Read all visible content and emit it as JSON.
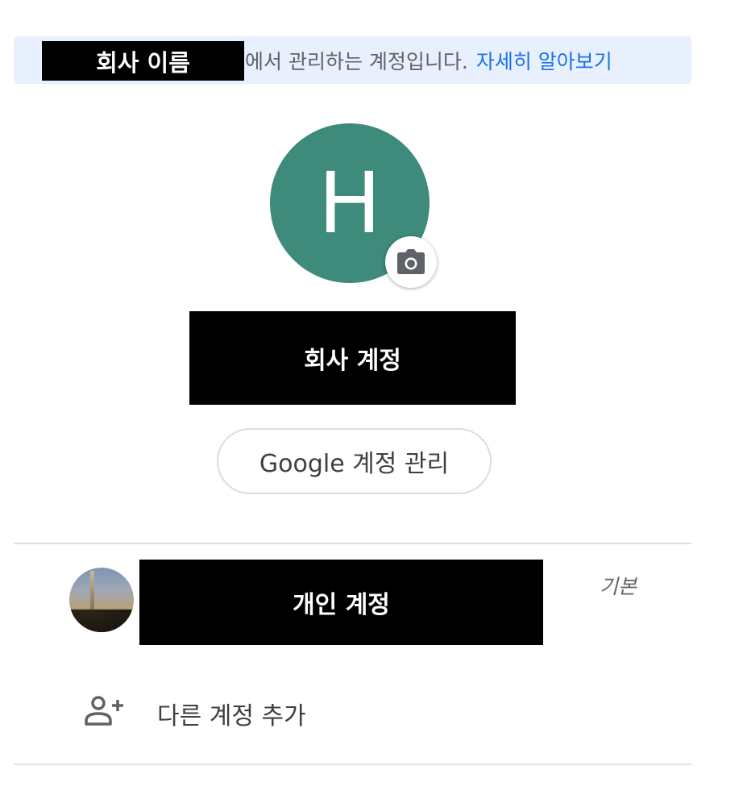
{
  "banner": {
    "org_name": "회사 이름",
    "managed_text": "에서 관리하는 계정입니다.",
    "learn_more": "자세히 알아보기"
  },
  "profile": {
    "initial": "H",
    "avatar_color": "#3e8a7b",
    "camera_icon": "camera-icon",
    "account_name": "회사 계정"
  },
  "manage_button": {
    "label": "Google 계정 관리"
  },
  "other_account": {
    "name": "개인 계정",
    "default_label": "기본"
  },
  "add_account": {
    "icon": "person-add-icon",
    "label": "다른 계정 추가"
  },
  "colors": {
    "link": "#1a73e8",
    "banner_bg": "#e8f0fe",
    "divider": "#e0e0e0"
  }
}
